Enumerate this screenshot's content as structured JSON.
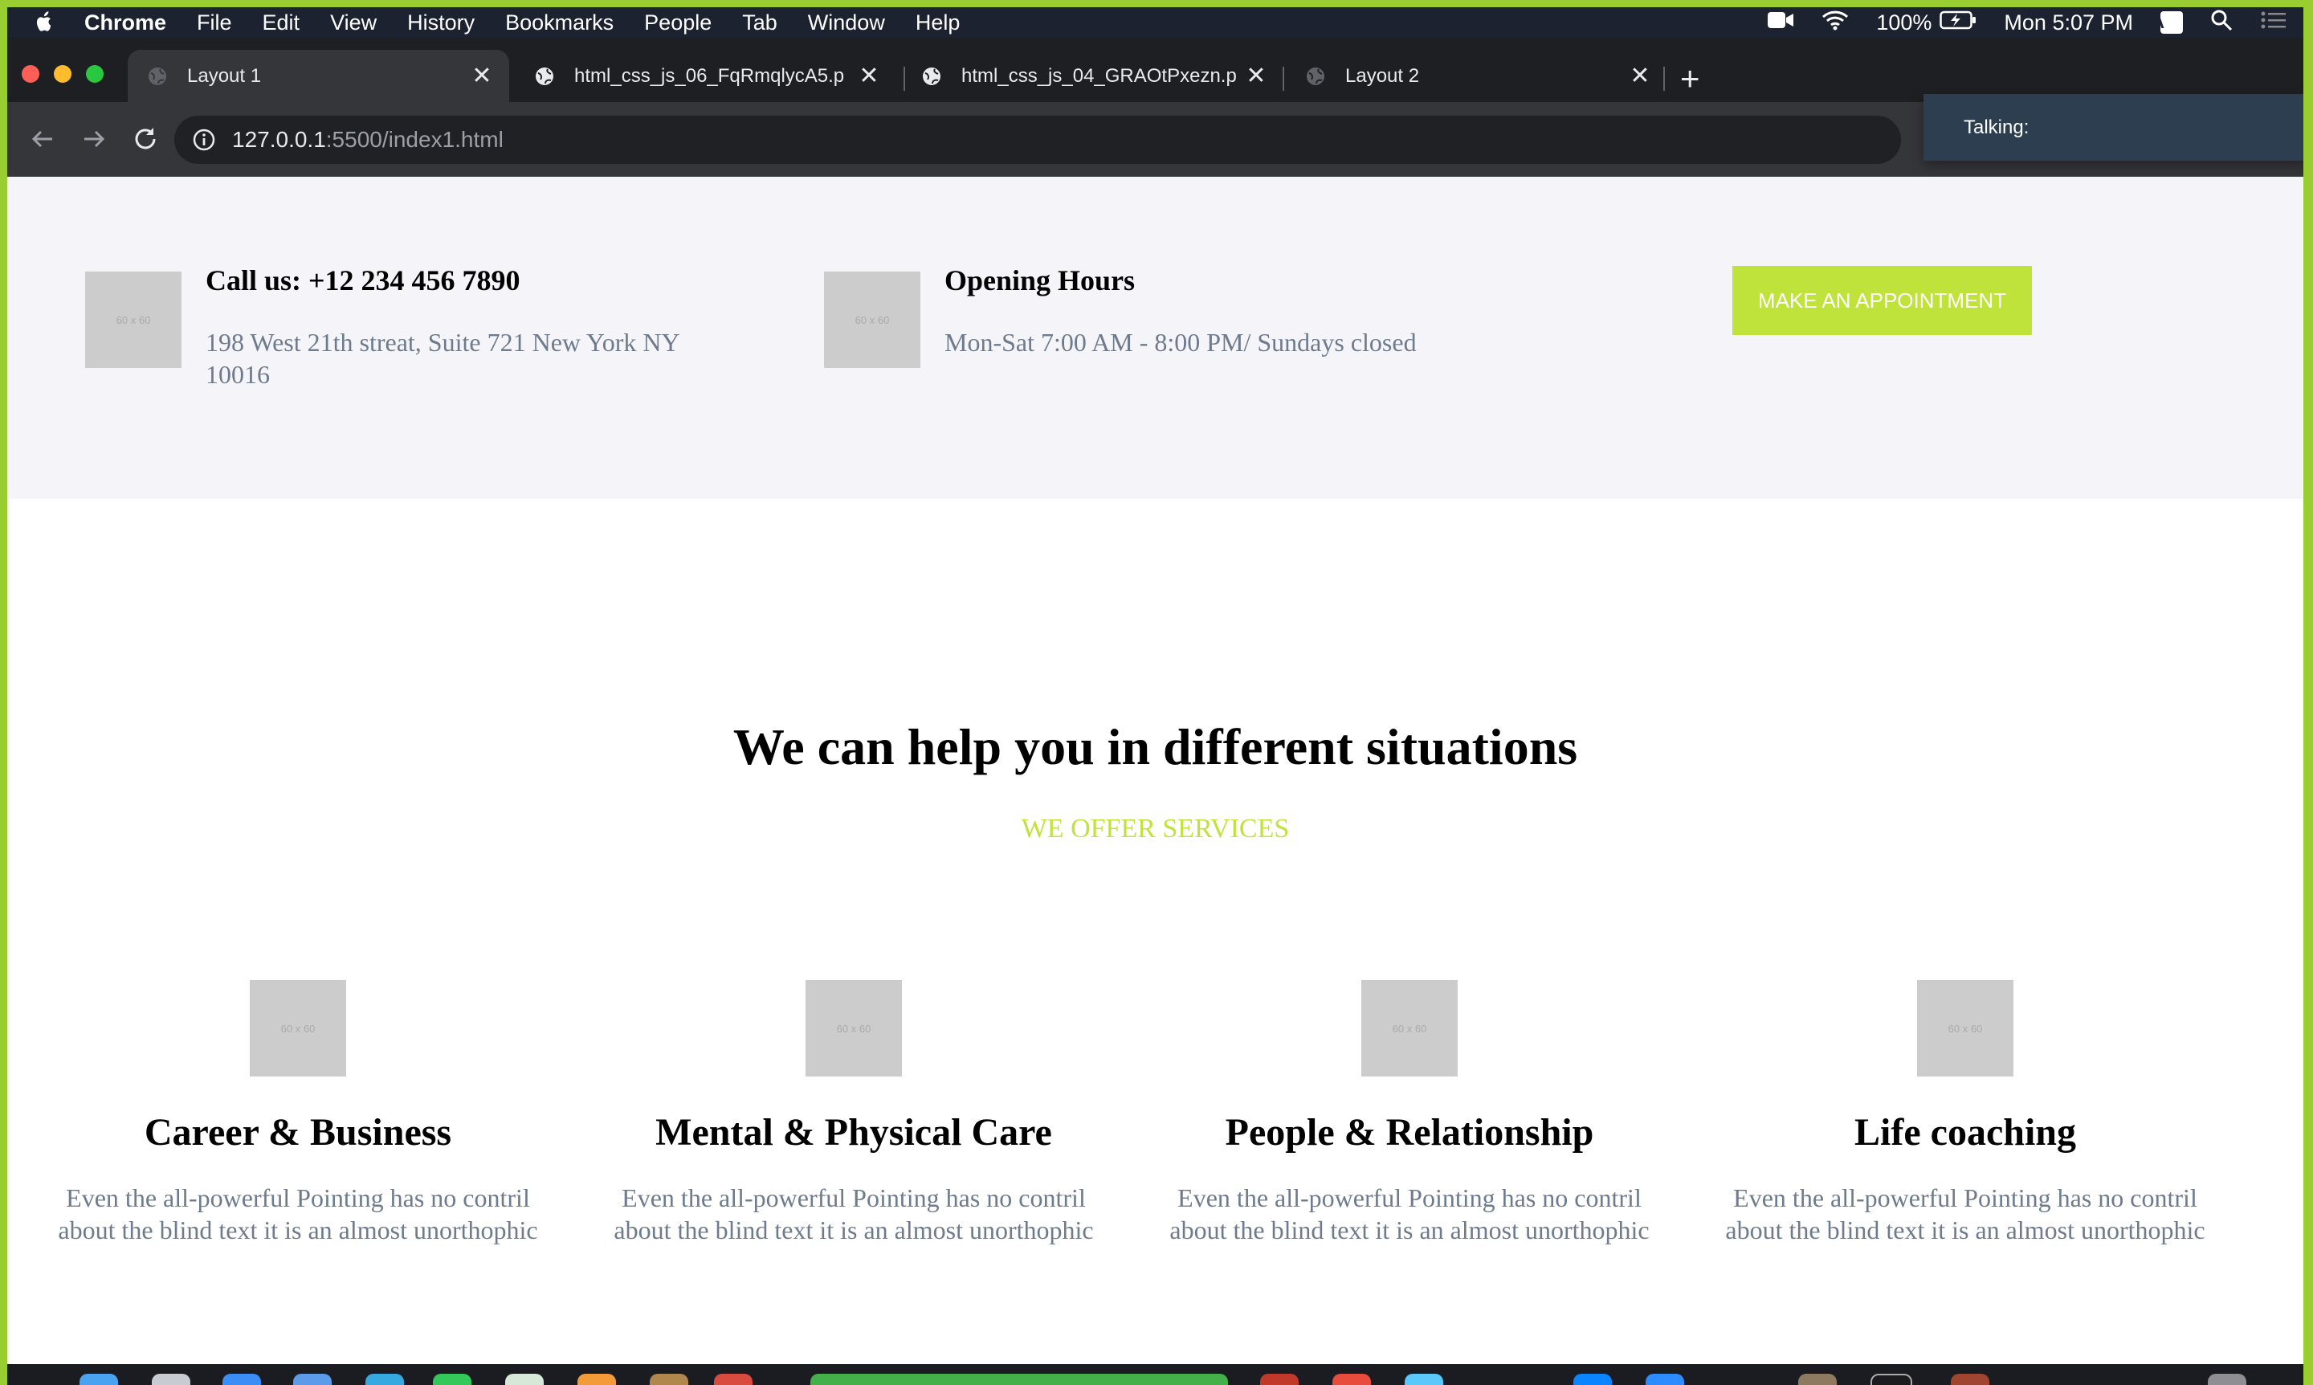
{
  "menubar": {
    "app": "Chrome",
    "items": [
      "File",
      "Edit",
      "View",
      "History",
      "Bookmarks",
      "People",
      "Tab",
      "Window",
      "Help"
    ],
    "battery": "100%",
    "clock": "Mon 5:07 PM",
    "input_source": "A"
  },
  "tabs": [
    {
      "title": "Layout 1",
      "active": true
    },
    {
      "title": "html_css_js_06_FqRmqlycA5.p",
      "active": false
    },
    {
      "title": "html_css_js_04_GRAOtPxezn.p",
      "active": false
    },
    {
      "title": "Layout 2",
      "active": false
    }
  ],
  "address": {
    "host": "127.0.0.1",
    "rest": ":5500/index1.html"
  },
  "talking": {
    "label": "Talking:"
  },
  "contact": {
    "placeholder_label": "60 x 60",
    "call": {
      "title": "Call us: +12 234 456 7890",
      "text": "198 West 21th streat, Suite 721 New York NY 10016"
    },
    "hours": {
      "title": "Opening Hours",
      "text": "Mon-Sat 7:00 AM - 8:00 PM/ Sundays closed"
    },
    "button": "MAKE AN APPOINTMENT"
  },
  "services": {
    "heading": "We can help you in different situations",
    "subheading": "WE OFFER SERVICES",
    "items": [
      {
        "title": "Career & Business",
        "text": "Even the all-powerful Pointing has no contril about the blind text it is an almost unorthophic"
      },
      {
        "title": "Mental & Physical Care",
        "text": "Even the all-powerful Pointing has no contril about the blind text it is an almost unorthophic"
      },
      {
        "title": "People & Relationship",
        "text": "Even the all-powerful Pointing has no contril about the blind text it is an almost unorthophic"
      },
      {
        "title": "Life coaching",
        "text": "Even the all-powerful Pointing has no contril about the blind text it is an almost unorthophic"
      }
    ]
  },
  "colors": {
    "accent": "#bfe33a",
    "frame": "#9acd32",
    "muted_text": "#6d7b8c",
    "section_bg": "#f5f5f9"
  }
}
